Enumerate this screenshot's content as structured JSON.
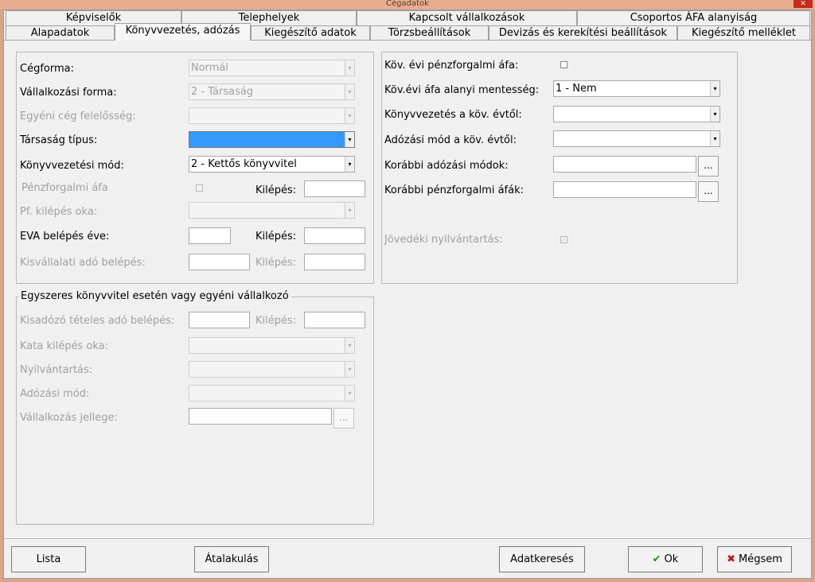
{
  "window": {
    "title": "Cégadatok",
    "close_icon": "close-icon"
  },
  "tabs_row1": [
    "Képviselők",
    "Telephelyek",
    "Kapcsolt vállalkozások",
    "Csoportos ÁFA alanyiság"
  ],
  "tabs_row2": [
    "Alapadatok",
    "Könyvvezetés, adózás",
    "Kiegészítő adatok",
    "Törzsbeállítások",
    "Devizás és kerekítési beállítások",
    "Kiegészítő melléklet"
  ],
  "left": {
    "cegforma": {
      "label": "Cégforma:",
      "value": "Normál"
    },
    "vallalkozasi_forma": {
      "label": "Vállalkozási forma:",
      "value": "2 - Társaság"
    },
    "egyeni_ceg": {
      "label": "Egyéni cég felelősség:",
      "value": ""
    },
    "tarsasag_tipus": {
      "label": "Társaság típus:",
      "value": ""
    },
    "konyvvezetesi_mod": {
      "label": "Könyvvezetési mód:",
      "value": "2 - Kettős könyvvitel"
    },
    "penzforgalmi_afa": {
      "label": "Pénzforgalmi áfa",
      "kilepes_label": "Kilépés:",
      "kilepes_value": ""
    },
    "pf_kilepes_oka": {
      "label": "Pf. kilépés oka:",
      "value": ""
    },
    "eva_belepes": {
      "label": "EVA belépés éve:",
      "value": "",
      "kilepes_label": "Kilépés:",
      "kilepes_value": ""
    },
    "kisvallalati_ado": {
      "label": "Kisvállalati adó belépés:",
      "value": "",
      "kilepes_label": "Kilépés:",
      "kilepes_value": ""
    }
  },
  "egyszeres": {
    "title": "Egyszeres könyvvitel esetén vagy egyéni vállalkozó",
    "kisadozo": {
      "label": "Kisadózó tételes adó belépés:",
      "value": "",
      "kilepes_label": "Kilépés:",
      "kilepes_value": ""
    },
    "kata_kilepes_oka": {
      "label": "Kata kilépés oka:",
      "value": ""
    },
    "nyilvantartas": {
      "label": "Nyilvántartás:",
      "value": ""
    },
    "adozasi_mod": {
      "label": "Adózási mód:",
      "value": ""
    },
    "vallalkozas_jellege": {
      "label": "Vállalkozás jellege:",
      "value": "",
      "button": "..."
    }
  },
  "right": {
    "kov_evi_penzforgalmi": {
      "label": "Köv. évi pénzforgalmi áfa:",
      "checked": false
    },
    "kov_evi_afa_mentesseg": {
      "label": "Köv.évi áfa alanyi mentesség:",
      "value": "1 - Nem"
    },
    "konyvvezetes_kov": {
      "label": "Könyvvezetés a köv. évtől:",
      "value": ""
    },
    "adozasi_mod_kov": {
      "label": "Adózási mód a köv. évtől:",
      "value": ""
    },
    "korabbi_adozasi": {
      "label": "Korábbi adózási módok:",
      "value": "",
      "button": "..."
    },
    "korabbi_penzforgalmi": {
      "label": "Korábbi pénzforgalmi áfák:",
      "value": "",
      "button": "..."
    },
    "jovedeki": {
      "label": "Jövedéki nyilvántartás:",
      "checked": true
    }
  },
  "buttons": {
    "lista": "Lista",
    "atalakulas": "Átalakulás",
    "adatkereses": "Adatkeresés",
    "ok": "Ok",
    "megsem": "Mégsem",
    "ok_icon": "✔",
    "megsem_icon": "✖"
  },
  "colors": {
    "ok_icon": "#1a9a1a",
    "megsem_icon": "#c0181a",
    "selection": "#3399ff",
    "titlebar": "#e7ad8e"
  }
}
